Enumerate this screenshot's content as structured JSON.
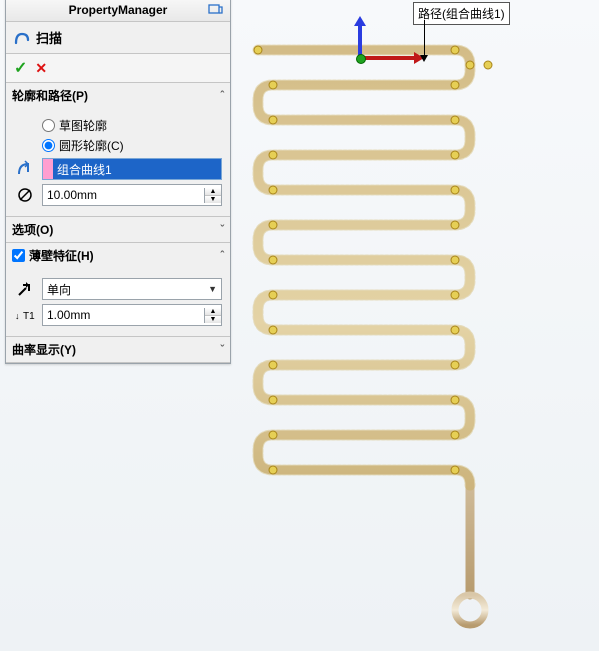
{
  "pm_title": "PropertyManager",
  "feature": {
    "icon": "sweep",
    "name": "扫描"
  },
  "actions": {
    "ok": "✓",
    "cancel": "✕"
  },
  "sections": {
    "profile_path": {
      "label": "轮廓和路径(P)",
      "radio_sketch": "草图轮廓",
      "radio_circle": "圆形轮廓(C)",
      "selected": "circle",
      "path_value": "组合曲线1",
      "diameter": "10.00mm"
    },
    "options": {
      "label": "选项(O)"
    },
    "thin": {
      "label": "薄壁特征(H)",
      "checked": true,
      "direction": "单向",
      "thickness": "1.00mm"
    },
    "curvature": {
      "label": "曲率显示(Y)"
    }
  },
  "callout": "路径(组合曲线1)"
}
